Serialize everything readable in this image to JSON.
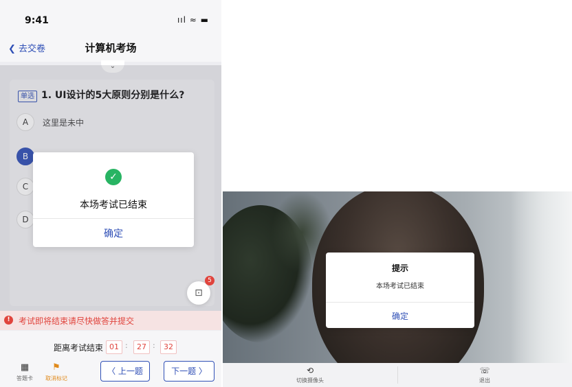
{
  "phone": {
    "status": {
      "time": "9:41",
      "signal": "ııl ≈ ▬"
    },
    "nav": {
      "back": "去交卷",
      "title": "计算机考场"
    },
    "collapse_icon": "⌄",
    "question": {
      "tag": "单选",
      "text": "1.  UI设计的5大原则分别是什么?",
      "options": [
        {
          "key": "A",
          "text": "这里是未中",
          "selected": false
        },
        {
          "key": "B",
          "text": "",
          "selected": true
        },
        {
          "key": "C",
          "text": "",
          "selected": false
        },
        {
          "key": "D",
          "text": "",
          "selected": false
        }
      ]
    },
    "dialog": {
      "icon": "✓",
      "message": "本场考试已结束",
      "confirm": "确定"
    },
    "chat": {
      "icon": "⊡",
      "badge": "5"
    },
    "warning": {
      "icon": "!",
      "text": "考试即将结束请尽快做答并提交"
    },
    "timer": {
      "label": "距离考试结束",
      "h": "01",
      "m": "27",
      "s": "32",
      "sep": ":"
    },
    "bottom": {
      "answer_card": {
        "icon": "▦",
        "label": "答题卡"
      },
      "flag": {
        "icon": "⚑",
        "label": "取消标记"
      },
      "prev": "〈  上一题",
      "next": "下一题  〉"
    }
  },
  "video": {
    "dialog": {
      "title": "提示",
      "message": "本场考试已结束",
      "confirm": "确定"
    },
    "bar": {
      "camera": {
        "icon": "⟲",
        "label": "切换摄像头"
      },
      "exit": {
        "icon": "☏",
        "label": "退出"
      }
    }
  },
  "colors": {
    "primary": "#2f4fb6",
    "danger": "#e0443d",
    "success": "#28b463"
  }
}
